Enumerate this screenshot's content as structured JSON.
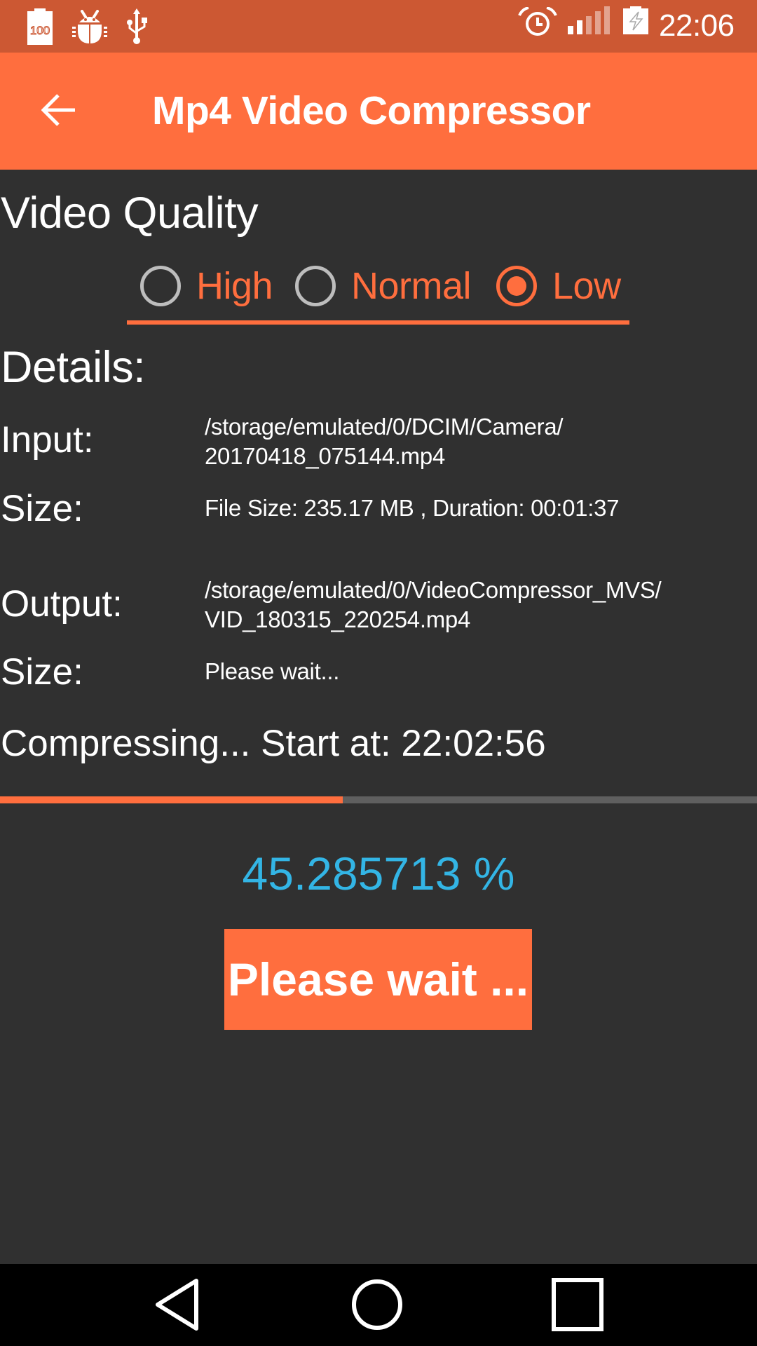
{
  "status_bar": {
    "left_icons": [
      "battery-100-icon",
      "debug-bug-icon",
      "usb-icon"
    ],
    "battery_level_label": "100",
    "right_icons": [
      "alarm-icon",
      "signal-icon",
      "battery-charging-icon"
    ],
    "signal_bars_filled": 2,
    "signal_bars_total": 5,
    "time": "22:06"
  },
  "app_bar": {
    "back_icon": "arrow-left-icon",
    "title": "Mp4 Video Compressor"
  },
  "quality": {
    "heading": "Video Quality",
    "options": [
      {
        "label": "High",
        "checked": false
      },
      {
        "label": "Normal",
        "checked": false
      },
      {
        "label": "Low",
        "checked": true
      }
    ],
    "selected": "Low"
  },
  "details": {
    "heading": "Details:",
    "input_label": "Input:",
    "input_value": "/storage/emulated/0/DCIM/Camera/\n20170418_075144.mp4",
    "input_size_label": "Size:",
    "input_size_value": "File Size: 235.17 MB , Duration: 00:01:37",
    "output_label": "Output:",
    "output_value": "/storage/emulated/0/VideoCompressor_MVS/\nVID_180315_220254.mp4",
    "output_size_label": "Size:",
    "output_size_value": "Please wait..."
  },
  "progress": {
    "status_text": "Compressing... Start at: 22:02:56",
    "percent_value": 45.285713,
    "percent_text": "45.285713 %"
  },
  "action_button": {
    "label": "Please wait ..."
  },
  "colors": {
    "status_bar": "#CC5833",
    "accent": "#FF6E3E",
    "background": "#303030",
    "percent_text": "#33B5E5",
    "progress_track": "#5F5F5F",
    "radio_unchecked": "#BDBDBD"
  },
  "nav_bar": {
    "buttons": [
      "back-triangle-icon",
      "home-circle-icon",
      "recents-square-icon"
    ]
  }
}
